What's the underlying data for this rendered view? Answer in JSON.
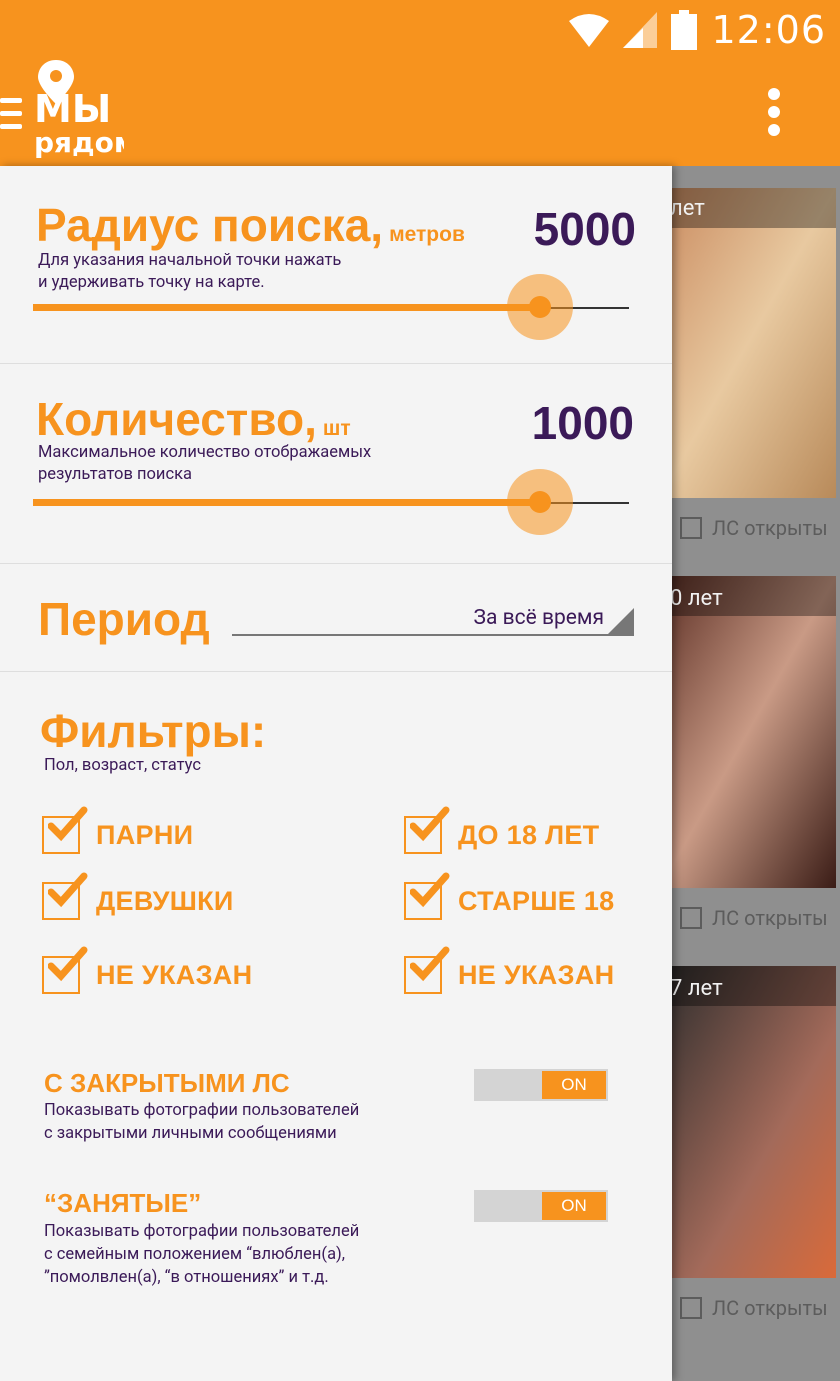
{
  "status_bar": {
    "time": "12:06"
  },
  "app_bar": {
    "logo_line1": "МЫ",
    "logo_line2": "рядом"
  },
  "radius": {
    "title": "Радиус поиска,",
    "unit": "метров",
    "value": "5000",
    "desc_line1": "Для указания начальной точки нажать",
    "desc_line2": "и удерживать точку на карте.",
    "slider_fraction": 0.85
  },
  "count": {
    "title": "Количество,",
    "unit": "шт",
    "value": "1000",
    "desc_line1": "Максимальное количество отображаемых",
    "desc_line2": "результатов поиска",
    "slider_fraction": 0.85
  },
  "period": {
    "title": "Период",
    "selected": "За всё время"
  },
  "filters": {
    "title": "Фильтры:",
    "subtitle": "Пол, возраст, статус",
    "gender": [
      {
        "label": "ПАРНИ",
        "checked": true
      },
      {
        "label": "ДЕВУШКИ",
        "checked": true
      },
      {
        "label": "НЕ УКАЗАН",
        "checked": true
      }
    ],
    "age": [
      {
        "label": "ДО 18 ЛЕТ",
        "checked": true
      },
      {
        "label": "СТАРШЕ 18",
        "checked": true
      },
      {
        "label": "НЕ УКАЗАН",
        "checked": true
      }
    ]
  },
  "closed_pm": {
    "title": "С ЗАКРЫТЫМИ ЛС",
    "desc_line1": "Показывать фотографии пользователей",
    "desc_line2": "с закрытыми личными сообщениями",
    "toggle": "ON"
  },
  "busy": {
    "title": "“ЗАНЯТЫЕ”",
    "desc_line1": "Показывать фотографии пользователей",
    "desc_line2": "с семейным положением “влюблен(а),",
    "desc_line3": "”помолвлен(а), “в отношениях” и т.д.",
    "toggle": "ON"
  },
  "feed": {
    "cards": [
      {
        "age": "лет",
        "ls": "ЛС открыты"
      },
      {
        "age": "0 лет",
        "ls": "ЛС открыты"
      },
      {
        "age": "7 лет",
        "ls": "ЛС открыты"
      }
    ]
  },
  "colors": {
    "accent": "#f7931e",
    "text_dark": "#3b1a58",
    "drawer_bg": "#f4f4f4"
  }
}
